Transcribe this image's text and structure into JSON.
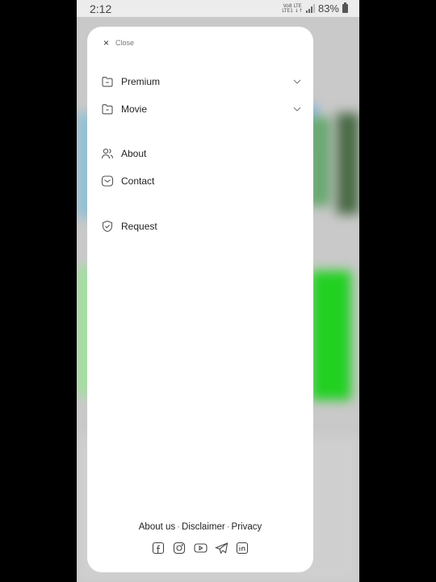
{
  "status_bar": {
    "time": "2:12",
    "net_top": "Vo8 LTE",
    "net_bottom": "LTE1 ↓↑",
    "battery": "83%"
  },
  "drawer": {
    "close_icon": "×",
    "close_label": "Close",
    "menu_group_1": [
      {
        "label": "Premium",
        "icon": "folder-icon",
        "expandable": true
      },
      {
        "label": "Movie",
        "icon": "folder-icon",
        "expandable": true
      }
    ],
    "menu_group_2": [
      {
        "label": "About",
        "icon": "users-icon"
      },
      {
        "label": "Contact",
        "icon": "mail-icon"
      }
    ],
    "menu_group_3": [
      {
        "label": "Request",
        "icon": "shield-check-icon"
      }
    ]
  },
  "footer": {
    "links": [
      "About us",
      "Disclaimer",
      "Privacy"
    ],
    "separator": "·",
    "socials": [
      "facebook-icon",
      "instagram-icon",
      "youtube-icon",
      "telegram-icon",
      "linkedin-icon"
    ]
  }
}
